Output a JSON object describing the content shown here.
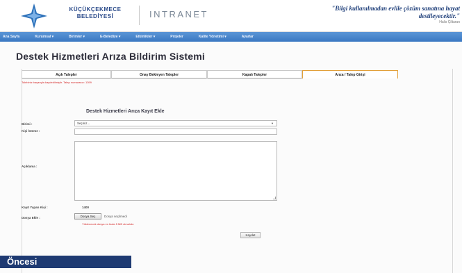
{
  "header": {
    "logo_text": "KÜÇÜKÇEKMECE BELEDİYESİ",
    "intranet_label": "INTRANET",
    "quote": "\"Bilgi kullanılmadan evlile çözüm sanatına hayat destileyecektir.\"",
    "quote_author": "Halis Çiltaran",
    "brand_color": "#2a4a8a"
  },
  "nav": {
    "items": [
      "Ana Sayfa",
      "Kurumsal ▾",
      "Birimler ▾",
      "E-Belediye ▾",
      "Etkinlikler ▾",
      "Projeler",
      "Kalite Yönetimi ▾",
      "Ayarlar"
    ],
    "color": "#3a78c2"
  },
  "page": {
    "title": "Destek Hizmetleri Arıza Bildirim Sistemi",
    "tabs": [
      {
        "label": "Açık Talepler",
        "active": false
      },
      {
        "label": "Onay Bekleyen Talepler",
        "active": false
      },
      {
        "label": "Kapalı Talepler",
        "active": false
      },
      {
        "label": "Arıza / Talep Girişi",
        "active": true
      }
    ],
    "alert": "Talebiniz başarıyla kaydedilmiştir. Talep numaranız: 1399"
  },
  "form": {
    "title": "Destek Hizmetleri Arıza Kayıt Ekle",
    "birim_label": "Birimi :",
    "birim_value": "Seçiniz...",
    "kisi_label": "Kişi İsteme :",
    "kisi_value": "",
    "aciklama_label": "Açıklama :",
    "aciklama_value": "",
    "kayit_label": "Kayıt Yapan Kişi :",
    "kayit_value": "1400",
    "dosya_label": "Dosya Ekle :",
    "file_button": "Dosya Seç",
    "file_status": "Dosya seçilmedi",
    "file_note": "Yüklenecek dosya en fazla 5 MB olmalıdır.",
    "submit": "Kaydet"
  },
  "caption": "Öncesi"
}
